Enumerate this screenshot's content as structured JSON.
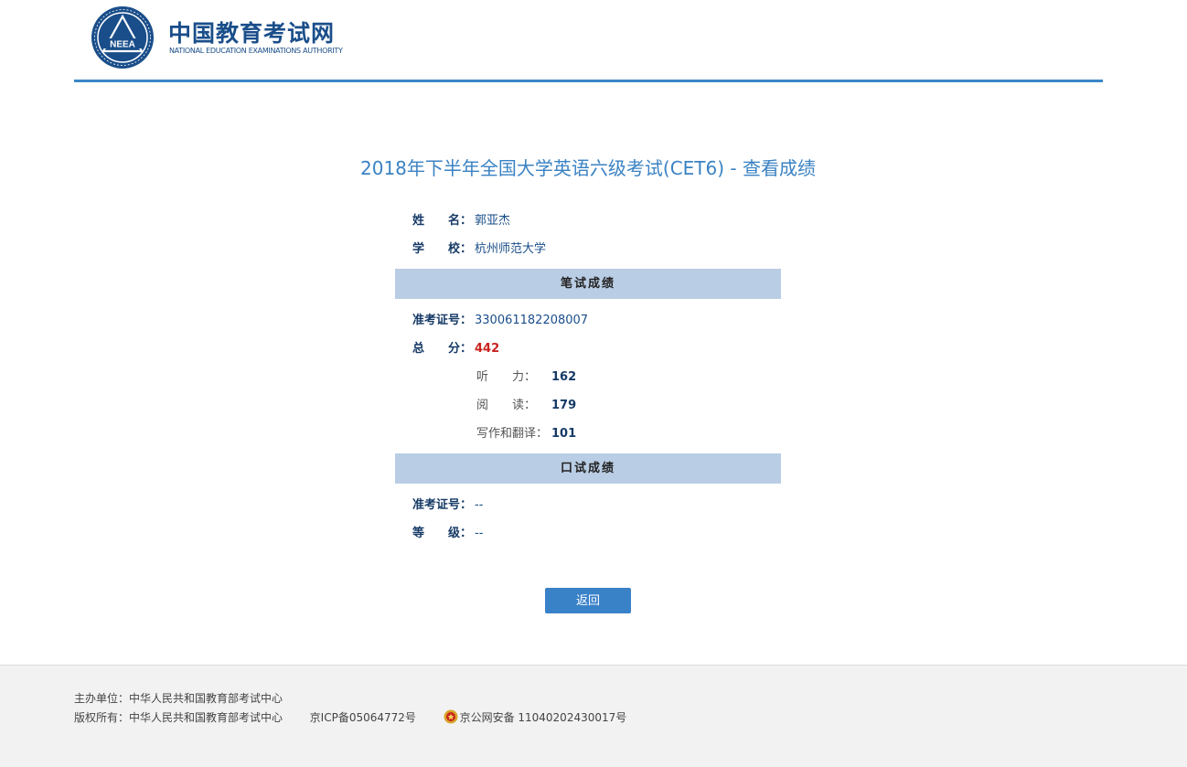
{
  "header": {
    "logo_emblem_text": "NEEA",
    "logo_cn": "中国教育考试网",
    "logo_en": "NATIONAL EDUCATION EXAMINATIONS AUTHORITY"
  },
  "title": "2018年下半年全国大学英语六级考试(CET6) - 查看成绩",
  "candidate": {
    "name_label": "姓　　名：",
    "name": "郭亚杰",
    "school_label": "学　　校：",
    "school": "杭州师范大学"
  },
  "written": {
    "section_title": "笔试成绩",
    "ticket_label": "准考证号：",
    "ticket": "330061182208007",
    "total_label": "总　　分：",
    "total": "442",
    "listening_label": "听　　力：",
    "listening": "162",
    "reading_label": "阅　　读：",
    "reading": "179",
    "writing_label": "写作和翻译：",
    "writing": "101"
  },
  "oral": {
    "section_title": "口试成绩",
    "ticket_label": "准考证号：",
    "ticket": "--",
    "level_label": "等　　级：",
    "level": "--"
  },
  "actions": {
    "back_label": "返回"
  },
  "footer": {
    "sponsor": "主办单位：中华人民共和国教育部考试中心",
    "copyright": "版权所有：中华人民共和国教育部考试中心",
    "icp": "京ICP备05064772号",
    "police": "京公网安备 11040202430017号"
  },
  "colors": {
    "accent": "#3a82c8",
    "header_line": "#3a87c8",
    "section_bar": "#b9cde4",
    "score_red": "#c8231f",
    "label_navy": "#163a66"
  }
}
